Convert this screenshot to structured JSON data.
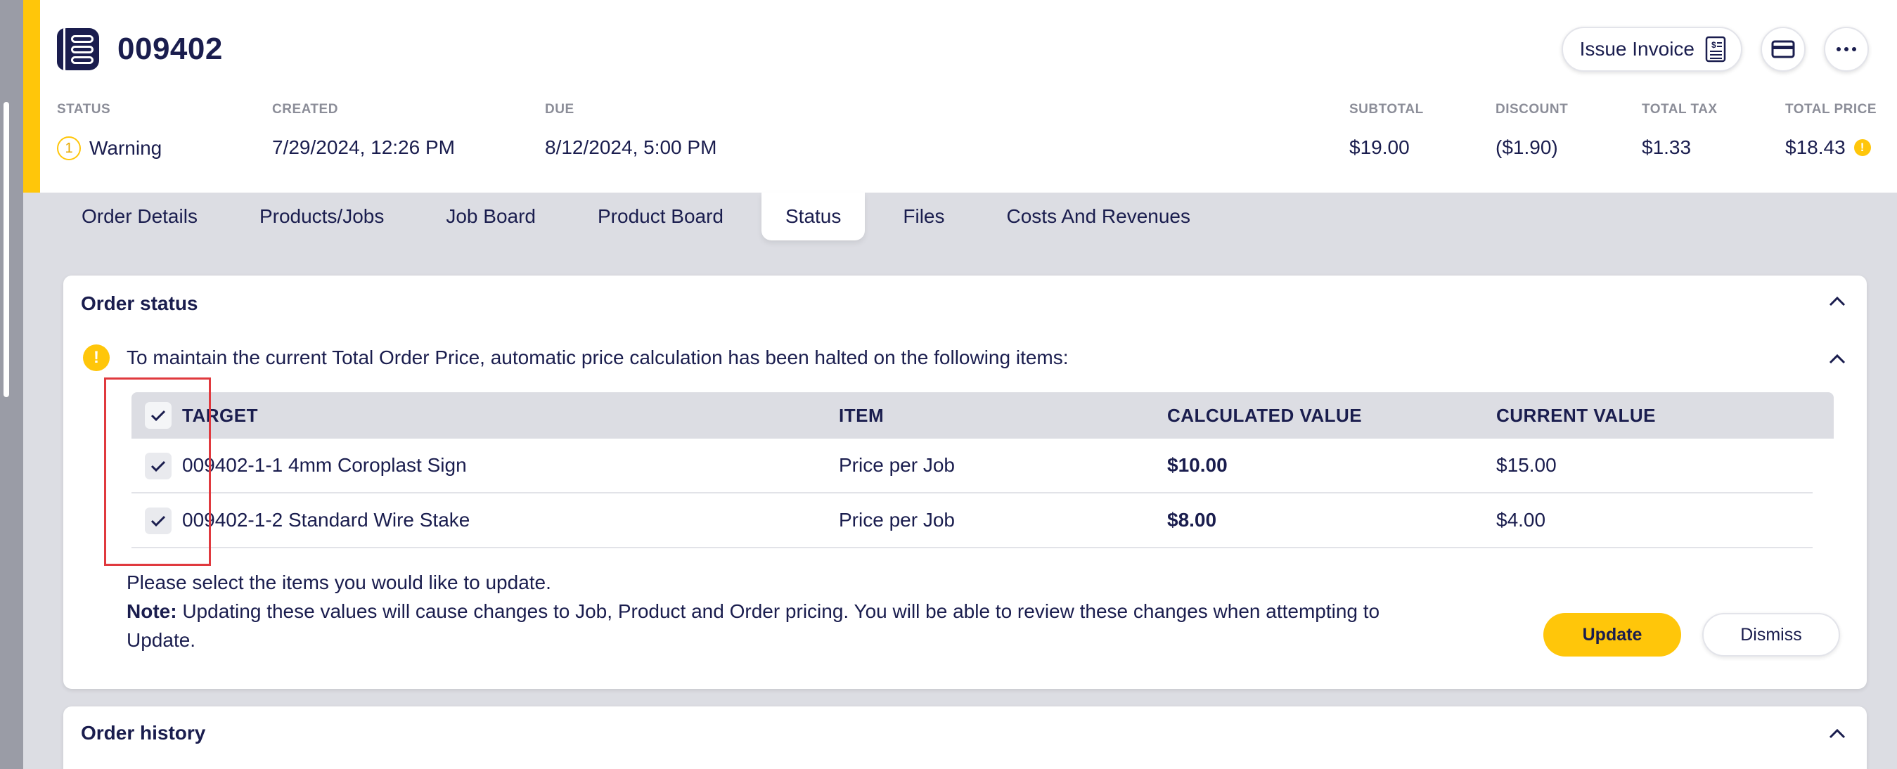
{
  "order": {
    "number": "009402"
  },
  "actions": {
    "issue_invoice": "Issue Invoice",
    "icons": [
      "invoice-icon",
      "credit-card-icon",
      "more-icon"
    ]
  },
  "meta": {
    "status_label": "STATUS",
    "status_count": "1",
    "status_value": "Warning",
    "created_label": "CREATED",
    "created_value": "7/29/2024, 12:26 PM",
    "due_label": "DUE",
    "due_value": "8/12/2024, 5:00 PM",
    "subtotal_label": "SUBTOTAL",
    "subtotal_value": "$19.00",
    "discount_label": "DISCOUNT",
    "discount_value": "($1.90)",
    "tax_label": "TOTAL TAX",
    "tax_value": "$1.33",
    "total_label": "TOTAL PRICE",
    "total_value": "$18.43",
    "total_warning": "!"
  },
  "tabs": [
    {
      "label": "Order Details"
    },
    {
      "label": "Products/Jobs"
    },
    {
      "label": "Job Board"
    },
    {
      "label": "Product Board"
    },
    {
      "label": "Status",
      "active": true
    },
    {
      "label": "Files"
    },
    {
      "label": "Costs And Revenues"
    }
  ],
  "order_status": {
    "title": "Order status",
    "warning_icon": "!",
    "warning_text": "To maintain the current Total Order Price, automatic price calculation has been halted on the following items:",
    "table": {
      "headers": [
        "TARGET",
        "ITEM",
        "CALCULATED VALUE",
        "CURRENT VALUE"
      ],
      "header_checked": true,
      "rows": [
        {
          "checked": true,
          "target": "009402-1-1 4mm Coroplast Sign",
          "item": "Price per Job",
          "calculated": "$10.00",
          "current": "$15.00"
        },
        {
          "checked": true,
          "target": "009402-1-2 Standard Wire Stake",
          "item": "Price per Job",
          "calculated": "$8.00",
          "current": "$4.00"
        }
      ]
    },
    "prompt": "Please select the items you would like to update.",
    "note_label": "Note:",
    "note_text": " Updating these values will cause changes to Job, Product and Order pricing. You will be able to review these changes when attempting to",
    "note_text_cont": "Update.",
    "update_label": "Update",
    "dismiss_label": "Dismiss"
  },
  "order_history": {
    "title": "Order history"
  },
  "colors": {
    "accent": "#ffc60a",
    "text": "#1a1d4e",
    "highlight": "#e0393e",
    "background": "#dcdde3"
  }
}
